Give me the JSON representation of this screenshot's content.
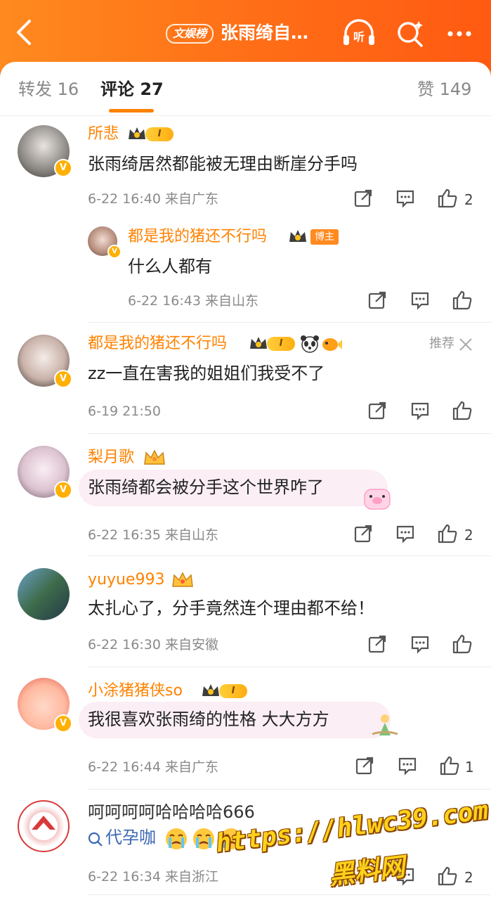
{
  "header": {
    "tag": "文娱榜",
    "title": "张雨绮自…",
    "listen_icon_label": "听",
    "icons": [
      "back-icon",
      "listen-icon",
      "search-icon",
      "more-icon"
    ]
  },
  "tabs": [
    {
      "label": "转发 16"
    },
    {
      "label": "评论 27"
    },
    {
      "label": "赞 149"
    }
  ],
  "comments": [
    {
      "name": "所悲",
      "level": "I",
      "text": "张雨绮居然都能被无理由断崖分手吗",
      "meta": "6-22 16:40 来自广东",
      "likes": "2"
    },
    {
      "name": "都是我的猪还不行吗",
      "badge": "博主",
      "text": "什么人都有",
      "meta": "6-22 16:43 来自山东"
    },
    {
      "name": "都是我的猪还不行吗",
      "level": "I",
      "recommend": "推荐",
      "text": "zz一直在害我的姐姐们我受不了",
      "meta": "6-19 21:50"
    },
    {
      "name": "梨月歌",
      "text": "张雨绮都会被分手这个世界咋了",
      "meta": "6-22 16:35 来自山东",
      "likes": "2"
    },
    {
      "name": "yuyue993",
      "text": "太扎心了，分手竟然连个理由都不给！",
      "meta": "6-22 16:30 来自安徽"
    },
    {
      "name": "小涂猪猪侠so",
      "level": "I",
      "text": "我很喜欢张雨绮的性格 大大方方",
      "meta": "6-22 16:44 来自广东",
      "likes": "1"
    },
    {
      "text": "呵呵呵呵哈哈哈哈666",
      "link": "代孕咖",
      "meta": "6-22 16:34 来自浙江",
      "likes": "2"
    }
  ],
  "watermark": {
    "line1": "https://hlwc39.com",
    "line2": "黑料网"
  },
  "colors": {
    "accent": "#ff8200",
    "header": "#ff7a1a",
    "name": "#ff8200",
    "link": "#3a67b5"
  }
}
